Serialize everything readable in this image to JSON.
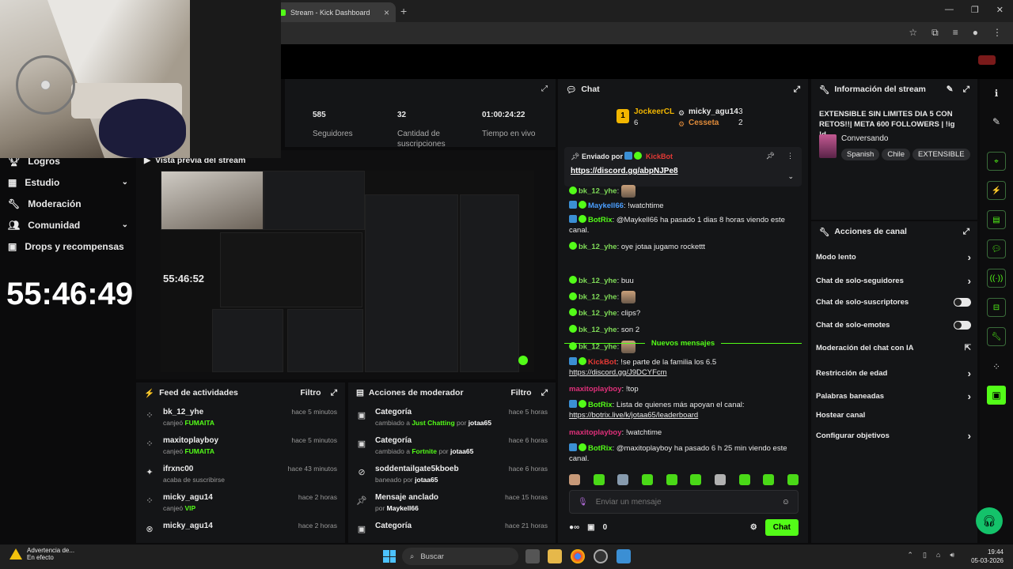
{
  "browser": {
    "tab_title": "Stream - Kick Dashboard",
    "new_tab": "+",
    "controls": [
      "—",
      "❐",
      "✕"
    ]
  },
  "nav": {
    "items": [
      {
        "label": "Logros",
        "chevron": false
      },
      {
        "label": "Estudio",
        "chevron": true
      },
      {
        "label": "Moderación",
        "chevron": false
      },
      {
        "label": "Comunidad",
        "chevron": true
      },
      {
        "label": "Drops y recompensas",
        "chevron": false
      }
    ],
    "timer": "55:46:49"
  },
  "stats": [
    {
      "value": "585",
      "label": "Seguidores"
    },
    {
      "value": "32",
      "label": "Cantidad de suscripciones"
    },
    {
      "value": "01:00:24:22",
      "label": "Tiempo en vivo"
    }
  ],
  "preview": {
    "title": "Vista previa del stream",
    "timer": "55:46:52"
  },
  "feed": {
    "title": "Feed de actividades",
    "filter": "Filtro",
    "items": [
      {
        "name": "bk_12_yhe",
        "action": "canjeó",
        "target": "FUMAITA",
        "time": "hace 5 minutos",
        "icon": "redeem-icon"
      },
      {
        "name": "maxitoplayboy",
        "action": "canjeó",
        "target": "FUMAITA",
        "time": "hace 5 minutos",
        "icon": "redeem-icon"
      },
      {
        "name": "ifrxnc00",
        "action": "acaba de suscribirse",
        "target": "",
        "time": "hace 43 minutos",
        "icon": "sparkle-icon"
      },
      {
        "name": "micky_agu14",
        "action": "canjeó",
        "target": "VIP",
        "time": "hace 2 horas",
        "icon": "redeem-icon"
      },
      {
        "name": "micky_agu14",
        "action": "",
        "target": "",
        "time": "hace 2 horas",
        "icon": "kick-icon"
      }
    ]
  },
  "mod": {
    "title": "Acciones de moderador",
    "filter": "Filtro",
    "items": [
      {
        "name": "Categoría",
        "pre": "cambiado a",
        "value": "Just Chatting",
        "by": "por",
        "user": "jotaa65",
        "time": "hace 5 horas",
        "icon": "category-icon"
      },
      {
        "name": "Categoría",
        "pre": "cambiado a",
        "value": "Fortnite",
        "by": "por",
        "user": "jotaa65",
        "time": "hace 6 horas",
        "icon": "category-icon"
      },
      {
        "name": "soddentailgate5kboeb",
        "pre": "baneado",
        "value": "",
        "by": "por",
        "user": "jotaa65",
        "time": "hace 6 horas",
        "icon": "ban-icon"
      },
      {
        "name": "Mensaje anclado",
        "pre": "",
        "value": "",
        "by": "por",
        "user": "Maykell66",
        "time": "hace 15 horas",
        "icon": "pin-icon"
      },
      {
        "name": "Categoría",
        "pre": "",
        "value": "",
        "by": "",
        "user": "",
        "time": "hace 21 horas",
        "icon": "category-icon"
      }
    ]
  },
  "chat": {
    "title": "Chat",
    "podium": {
      "first": {
        "name": "JockeerCL",
        "count": "6"
      },
      "second": {
        "name": "micky_agu14",
        "count": "3"
      },
      "third": {
        "name": "Cesseta",
        "count": "2"
      }
    },
    "pinned": {
      "label": "Enviado por",
      "user": "KickBot",
      "link": "https://discord.gg/abpNJPe8"
    },
    "messages": [
      {
        "user": "bk_12_yhe",
        "color": "#7ed957",
        "text": "",
        "emote": true
      },
      {
        "user": "Maykell66",
        "color": "#4a9eff",
        "text": "!watchtime"
      },
      {
        "user": "BotRix",
        "color": "#53fc18",
        "text": "@Maykell66 ha pasado 1 dias 8 horas viendo este canal."
      },
      {
        "user": "bk_12_yhe",
        "color": "#7ed957",
        "text": "oye jotaa jugamo rockettt"
      }
    ],
    "new_messages": "Nuevos mensajes",
    "messages2": [
      {
        "user": "bk_12_yhe",
        "color": "#7ed957",
        "text": "buu"
      },
      {
        "user": "bk_12_yhe",
        "color": "#7ed957",
        "text": "",
        "emote": true
      },
      {
        "user": "bk_12_yhe",
        "color": "#7ed957",
        "text": "clips?"
      },
      {
        "user": "bk_12_yhe",
        "color": "#7ed957",
        "text": "son 2"
      },
      {
        "user": "bk_12_yhe",
        "color": "#7ed957",
        "text": "",
        "emote": true
      },
      {
        "user": "KickBot",
        "color": "#e53935",
        "text": "!se parte de la familia los 6.5",
        "link": "https://discord.gg/J9DCYFcm"
      },
      {
        "user": "maxitoplayboy",
        "color": "#e0307a",
        "text": "!top"
      },
      {
        "user": "BotRix",
        "color": "#53fc18",
        "text": "Lista de quienes más apoyan el canal:",
        "link": "https://botrix.live/k/jotaa65/leaderboard"
      },
      {
        "user": "maxitoplayboy",
        "color": "#e0307a",
        "text": "!watchtime"
      },
      {
        "user": "BotRix",
        "color": "#53fc18",
        "text": "@maxitoplayboy ha pasado 6 h 25 min viendo este canal."
      }
    ],
    "input_placeholder": "Enviar un mensaje",
    "points": "0",
    "send": "Chat"
  },
  "info": {
    "title": "Información del stream",
    "stream_title": "EXTENSIBLE SIN LIMITES DIA 5 CON RETOS!!| META 600 FOLLOWERS | !ig !d...",
    "category": "Conversando",
    "tags": [
      "Spanish",
      "Chile",
      "EXTENSIBLE"
    ]
  },
  "actions": {
    "title": "Acciones de canal",
    "items": [
      {
        "label": "Modo lento",
        "kind": "chevron"
      },
      {
        "label": "Chat de solo-seguidores",
        "kind": "chevron"
      },
      {
        "label": "Chat de solo-suscriptores",
        "kind": "toggle"
      },
      {
        "label": "Chat de solo-emotes",
        "kind": "toggle"
      },
      {
        "label": "Moderación del chat con IA",
        "kind": "external"
      },
      {
        "label": "Restricción de edad",
        "kind": "chevron"
      },
      {
        "label": "Palabras baneadas",
        "kind": "chevron"
      },
      {
        "label": "Hostear canal",
        "kind": "none"
      },
      {
        "label": "Configurar objetivos",
        "kind": "chevron"
      }
    ]
  },
  "taskbar": {
    "warning_title": "Advertencia de...",
    "warning_sub": "En efecto",
    "search": "Buscar",
    "time": "19:44",
    "date": "05-03-2026"
  },
  "colors": {
    "accent": "#53fc18",
    "panel": "#141517"
  }
}
